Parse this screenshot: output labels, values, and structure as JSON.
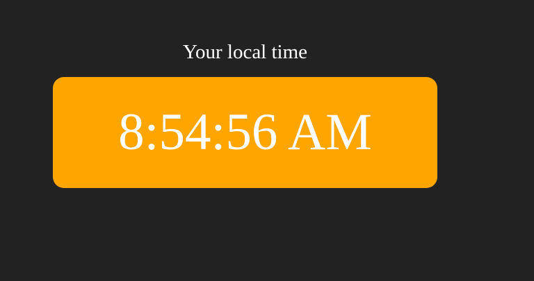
{
  "heading": "Your local time",
  "clock": {
    "time": "8:54:56 AM"
  },
  "colors": {
    "background": "#222222",
    "accent": "#ffa500",
    "text": "#ffffff"
  }
}
